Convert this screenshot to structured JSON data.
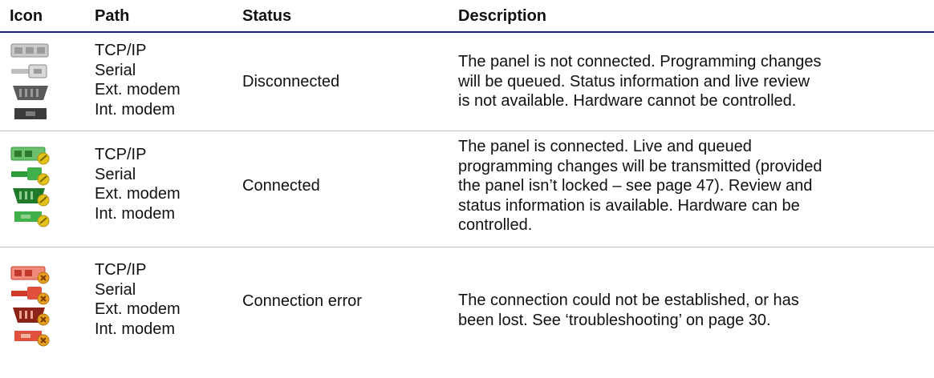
{
  "headers": {
    "icon": "Icon",
    "path": "Path",
    "status": "Status",
    "description": "Description"
  },
  "paths": [
    "TCP/IP",
    "Serial",
    "Ext. modem",
    "Int. modem"
  ],
  "rows": [
    {
      "status": "Disconnected",
      "description_lines": [
        "The panel is not connected. Programming changes",
        "will be queued. Status information and live review",
        "is not available. Hardware cannot be controlled."
      ],
      "icon_names": [
        "tcpip-disconnected-icon",
        "serial-disconnected-icon",
        "ext-modem-disconnected-icon",
        "int-modem-disconnected-icon"
      ],
      "icon_color": "#8a8a8a"
    },
    {
      "status": "Connected",
      "description_lines": [
        "The panel is connected. Live and queued",
        "programming changes will be transmitted (provided",
        "the panel isn’t locked – see page 47). Review and",
        "status information is available. Hardware can be",
        "controlled."
      ],
      "icon_names": [
        "tcpip-connected-icon",
        "serial-connected-icon",
        "ext-modem-connected-icon",
        "int-modem-connected-icon"
      ],
      "icon_color": "#2e9a3a",
      "badge_color": "#e3c21a"
    },
    {
      "status": "Connection error",
      "description_lines": [
        "The connection could not be established, or has",
        "been lost. See ‘troubleshooting’ on page 30."
      ],
      "icon_names": [
        "tcpip-error-icon",
        "serial-error-icon",
        "ext-modem-error-icon",
        "int-modem-error-icon"
      ],
      "icon_color": "#d23a2a",
      "badge_color": "#e8a020"
    }
  ]
}
